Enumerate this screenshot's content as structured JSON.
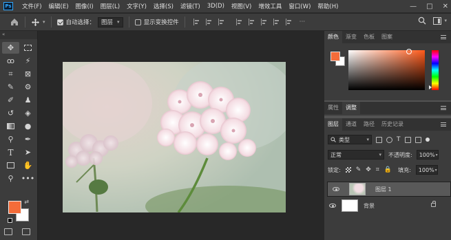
{
  "app": {
    "logo": "Ps"
  },
  "menu": [
    "文件(F)",
    "编辑(E)",
    "图像(I)",
    "图层(L)",
    "文字(Y)",
    "选择(S)",
    "滤镜(T)",
    "3D(D)",
    "视图(V)",
    "增效工具",
    "窗口(W)",
    "帮助(H)"
  ],
  "window_controls": {
    "minimize": "—",
    "maximize": "□",
    "close": "✕"
  },
  "options": {
    "auto_select_label": "自动选择：",
    "auto_select_checked": true,
    "target_value": "图层",
    "show_transform_label": "显示变换控件",
    "show_transform_checked": false
  },
  "toolbar": {
    "collapse": "«",
    "foreground_color": "#f46c39",
    "background_color": "#ffffff",
    "tools": [
      "move-icon",
      "marquee-icon",
      "lasso-icon",
      "magic-wand-icon",
      "crop-icon",
      "frame-icon",
      "eyedropper-icon",
      "patch-icon",
      "brush-icon",
      "stamp-icon",
      "history-brush-icon",
      "eraser-icon",
      "gradient-icon",
      "blur-icon",
      "dodge-icon",
      "pen-icon",
      "type-icon",
      "path-select-icon",
      "rectangle-icon",
      "hand-icon",
      "zoom-icon",
      "more-icon"
    ]
  },
  "color_panel": {
    "tabs": [
      "颜色",
      "渐变",
      "色板",
      "图案"
    ],
    "active_tab": "颜色",
    "foreground_color": "#f46c39",
    "background_color": "#ffffff"
  },
  "adjust_panel": {
    "tabs": [
      "属性",
      "调整"
    ],
    "active_tab": "调整"
  },
  "layers_panel": {
    "tabs": [
      "图层",
      "通道",
      "路径",
      "历史记录"
    ],
    "active_tab": "图层",
    "filter_kind": "类型",
    "blend_mode": "正常",
    "opacity_label": "不透明度:",
    "opacity_value": "100%",
    "lock_label": "锁定:",
    "fill_label": "填充:",
    "fill_value": "100%",
    "layers": [
      {
        "name": "图层 1",
        "selected": true,
        "locked": false
      },
      {
        "name": "背景",
        "selected": false,
        "locked": true
      }
    ]
  }
}
